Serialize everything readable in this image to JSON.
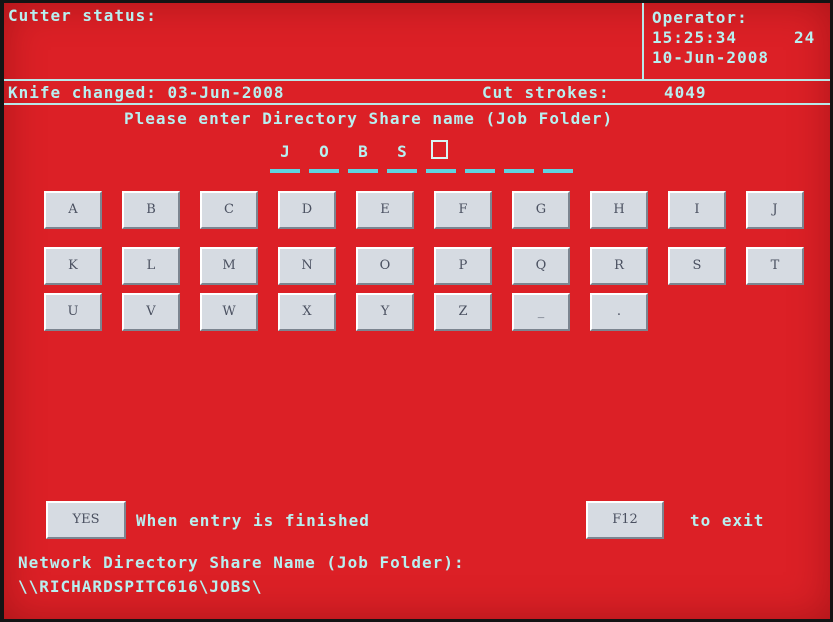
{
  "header": {
    "cutter_status_label": "Cutter status:",
    "operator_label": "Operator:",
    "time": "15:25:34",
    "time_suffix": "24",
    "date": "10-Jun-2008"
  },
  "info": {
    "knife_changed": "Knife changed: 03-Jun-2008",
    "cut_strokes_label": "Cut strokes:",
    "cut_strokes_value": "4049"
  },
  "prompt": "Please enter Directory Share name (Job Folder)",
  "entry": {
    "chars": [
      "J",
      "O",
      "B",
      "S",
      "",
      "",
      "",
      ""
    ],
    "cursor_index": 4
  },
  "keyboard": {
    "row1": [
      "A",
      "B",
      "C",
      "D",
      "E",
      "F",
      "G",
      "H",
      "I",
      "J"
    ],
    "row2": [
      "K",
      "L",
      "M",
      "N",
      "O",
      "P",
      "Q",
      "R",
      "S",
      "T"
    ],
    "row3": [
      "U",
      "V",
      "W",
      "X",
      "Y",
      "Z",
      "_",
      "."
    ]
  },
  "yes_button": "YES",
  "yes_caption": "When entry is finished",
  "f12_button": "F12",
  "f12_caption": "to exit",
  "footer": {
    "label": "Network Directory Share Name (Job Folder):",
    "path": "\\\\RICHARDSPITC616\\JOBS\\"
  },
  "colors": {
    "background": "#dc2026",
    "text": "#b8f0f0",
    "key_face": "#d6dbe2",
    "underline": "#5fd3e0"
  }
}
